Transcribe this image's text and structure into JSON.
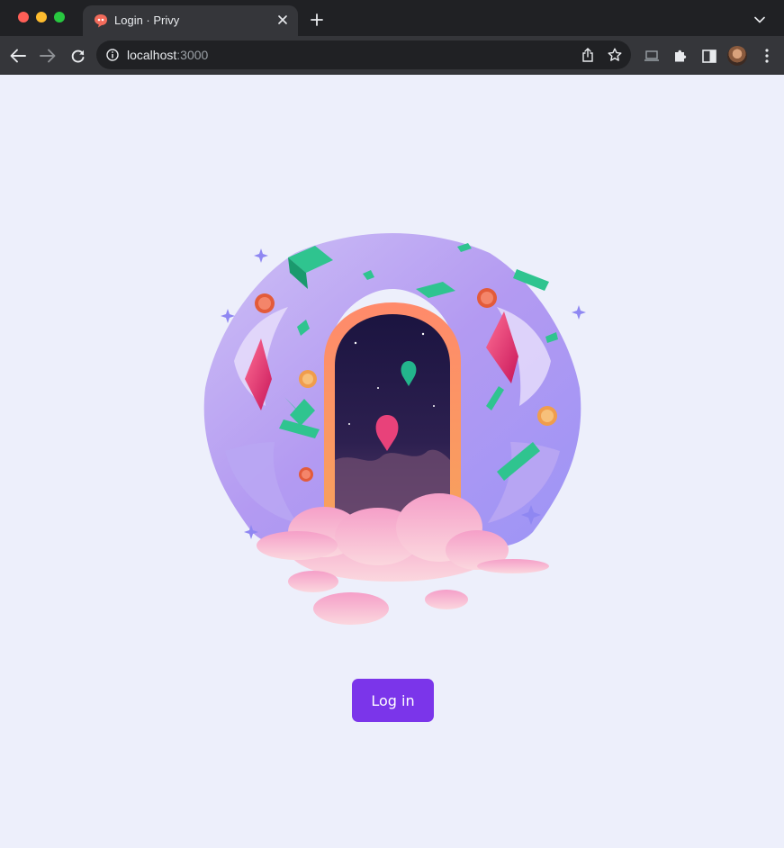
{
  "browser": {
    "tab": {
      "title": "Login · Privy",
      "favicon": "privy-favicon-icon"
    },
    "address_bar": {
      "host": "localhost",
      "port": ":3000"
    },
    "icons": {
      "back": "back-arrow-icon",
      "forward": "forward-arrow-icon",
      "reload": "reload-icon",
      "info": "info-icon",
      "share": "share-icon",
      "bookmark": "star-icon",
      "cast": "cast-icon",
      "extensions": "puzzle-icon",
      "side_panel": "side-panel-icon",
      "menu": "kebab-menu-icon"
    }
  },
  "page": {
    "illustration": "portal-illustration",
    "login_button": "Log in"
  },
  "colors": {
    "page_background": "#edeffb",
    "button_background": "#7b35ea",
    "button_text": "#ffffff"
  }
}
